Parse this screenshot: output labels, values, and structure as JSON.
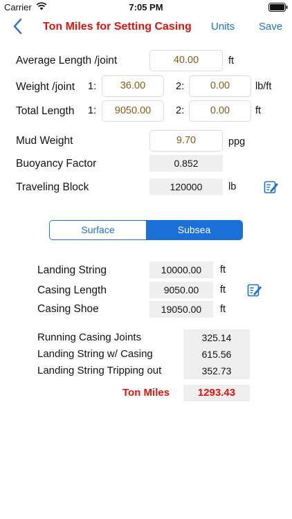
{
  "status": {
    "carrier": "Carrier",
    "time": "7:05 PM"
  },
  "nav": {
    "title": "Ton Miles for Setting Casing",
    "units_label": "Units",
    "save_label": "Save"
  },
  "inputs": {
    "avg_length": {
      "label": "Average Length /joint",
      "value": "40.00",
      "unit": "ft"
    },
    "weight": {
      "label": "Weight /joint",
      "idx1": "1:",
      "value1": "36.00",
      "idx2": "2:",
      "value2": "0.00",
      "unit": "lb/ft"
    },
    "total_length": {
      "label": "Total Length",
      "idx1": "1:",
      "value1": "9050.00",
      "idx2": "2:",
      "value2": "0.00",
      "unit": "ft"
    },
    "mud_weight": {
      "label": "Mud Weight",
      "value": "9.70",
      "unit": "ppg"
    },
    "buoyancy": {
      "label": "Buoyancy Factor",
      "value": "0.852"
    },
    "traveling_block": {
      "label": "Traveling Block",
      "value": "120000",
      "unit": "lb"
    }
  },
  "segment": {
    "options": [
      "Surface",
      "Subsea"
    ],
    "selected": "Subsea"
  },
  "subsea": {
    "landing_string": {
      "label": "Landing String",
      "value": "10000.00",
      "unit": "ft"
    },
    "casing_length": {
      "label": "Casing Length",
      "value": "9050.00",
      "unit": "ft"
    },
    "casing_shoe": {
      "label": "Casing Shoe",
      "value": "19050.00",
      "unit": "ft"
    }
  },
  "results": {
    "running_joints": {
      "label": "Running Casing Joints",
      "value": "325.14"
    },
    "landing_with_casing": {
      "label": "Landing String w/ Casing",
      "value": "615.56"
    },
    "landing_tripping": {
      "label": "Landing String Tripping out",
      "value": "352.73"
    },
    "ton_miles": {
      "label": "Ton Miles",
      "value": "1293.43"
    }
  },
  "colors": {
    "accent": "#1a6fd8",
    "title_red": "#e3120b",
    "input_text": "#8a5a14",
    "output_bg": "#efefef"
  }
}
